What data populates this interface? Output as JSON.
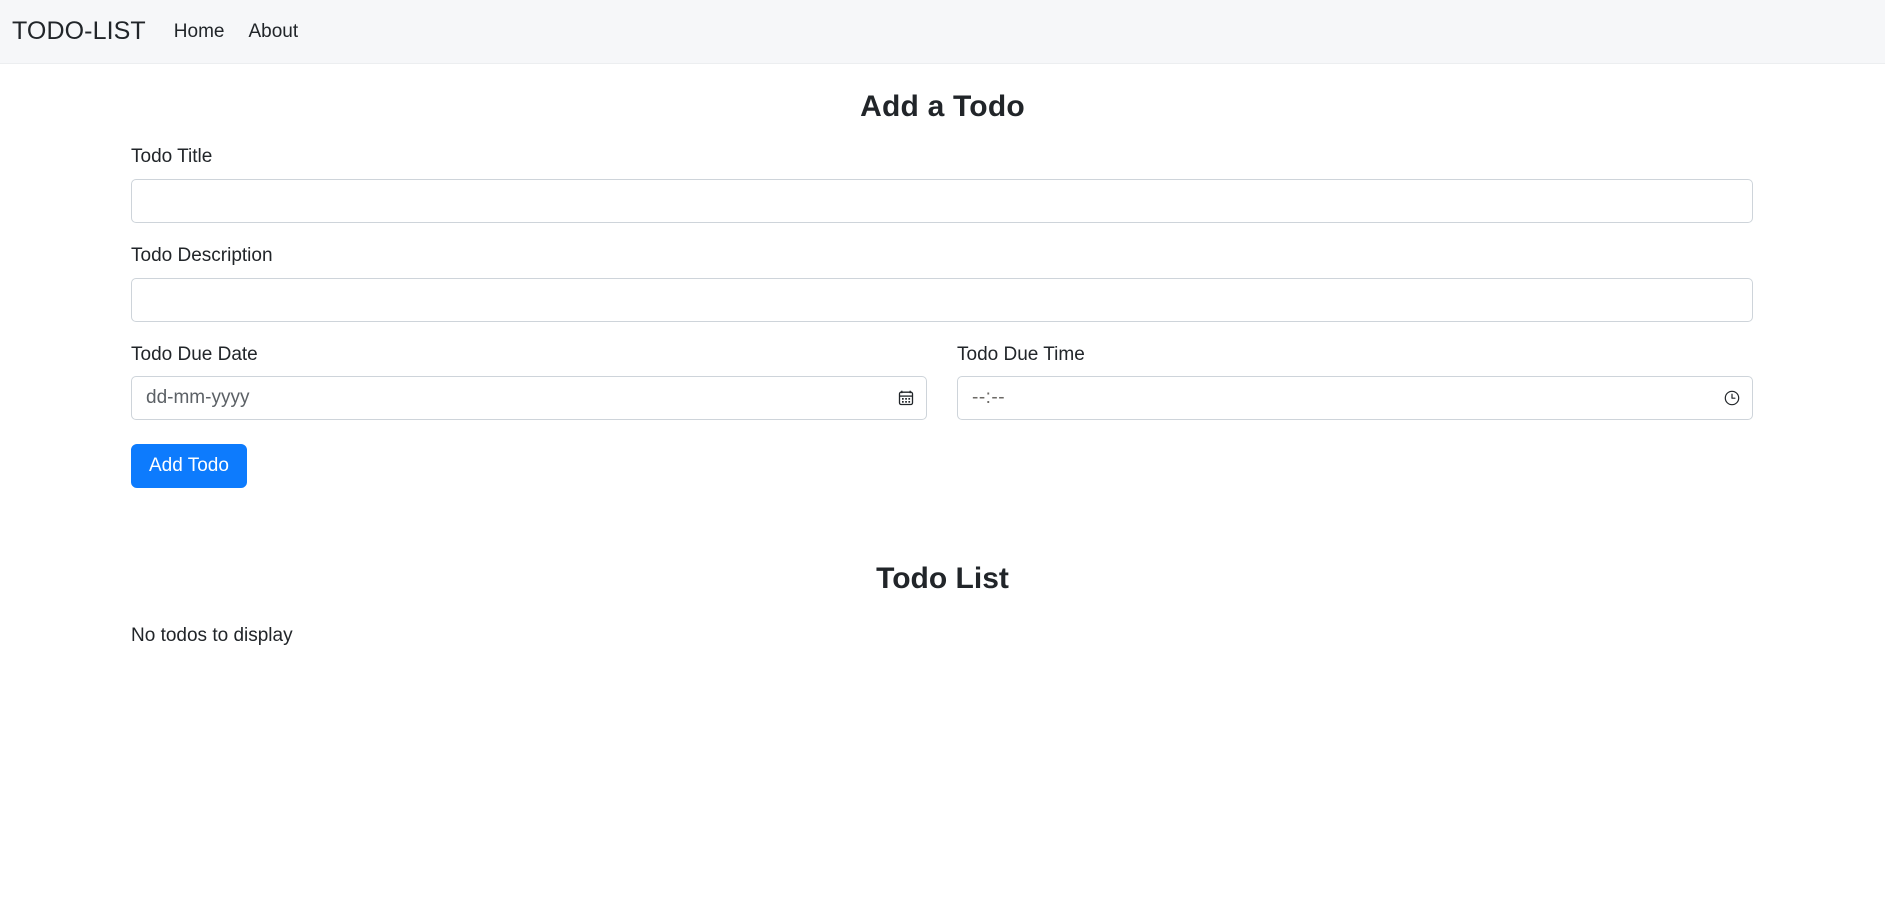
{
  "navbar": {
    "brand": "TODO-LIST",
    "links": [
      {
        "label": "Home",
        "name": "nav-link-home"
      },
      {
        "label": "About",
        "name": "nav-link-about"
      }
    ]
  },
  "form": {
    "heading": "Add a Todo",
    "title_field": {
      "label": "Todo Title",
      "value": "",
      "placeholder": ""
    },
    "description_field": {
      "label": "Todo Description",
      "value": "",
      "placeholder": ""
    },
    "due_date_field": {
      "label": "Todo Due Date",
      "value": "",
      "placeholder": "dd-mm-yyyy",
      "icon": "calendar-icon"
    },
    "due_time_field": {
      "label": "Todo Due Time",
      "value": "",
      "placeholder": "--:--",
      "icon": "clock-icon"
    },
    "submit_label": "Add Todo",
    "submit_color": "#0d7bfd"
  },
  "todo_list": {
    "heading": "Todo List",
    "empty_message": "No todos to display",
    "items": []
  },
  "theme": {
    "navbar_bg": "#f6f7f9",
    "page_bg": "#ffffff",
    "text_color": "#212529",
    "input_border": "#ced4da",
    "accent": "#0d7bfd"
  }
}
